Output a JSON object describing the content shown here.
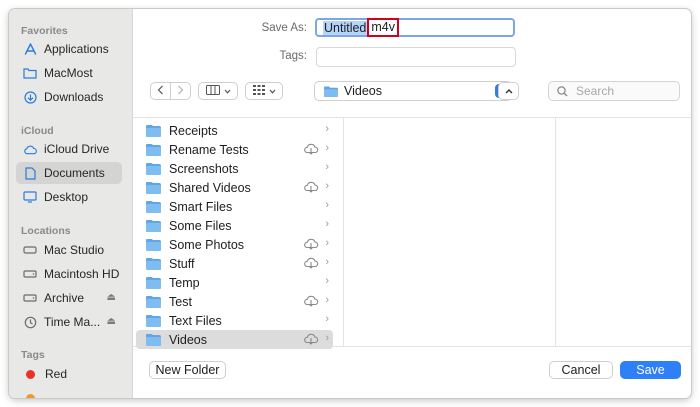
{
  "sidebar": {
    "favorites_heading": "Favorites",
    "favorites": [
      {
        "label": "Applications",
        "icon": "applications-icon"
      },
      {
        "label": "MacMost",
        "icon": "folder-icon"
      },
      {
        "label": "Downloads",
        "icon": "downloads-icon"
      }
    ],
    "icloud_heading": "iCloud",
    "icloud": [
      {
        "label": "iCloud Drive",
        "icon": "cloud-icon"
      },
      {
        "label": "Documents",
        "icon": "document-icon",
        "selected": true
      },
      {
        "label": "Desktop",
        "icon": "desktop-icon"
      }
    ],
    "locations_heading": "Locations",
    "locations": [
      {
        "label": "Mac Studio",
        "icon": "computer-icon"
      },
      {
        "label": "Macintosh HD",
        "icon": "drive-icon"
      },
      {
        "label": "Archive",
        "icon": "drive-icon",
        "ejectable": true
      },
      {
        "label": "Time Ma...",
        "icon": "time-machine-icon",
        "ejectable": true
      }
    ],
    "tags_heading": "Tags",
    "tags": [
      {
        "label": "Red",
        "color": "#e8332a"
      },
      {
        "label": "",
        "color": "#f0982f"
      }
    ]
  },
  "form": {
    "save_as_label": "Save As:",
    "filename_selected": "Untitled",
    "filename_extension": "m4v",
    "tags_label": "Tags:"
  },
  "toolbar": {
    "location": "Videos",
    "search_placeholder": "Search"
  },
  "browser": {
    "items": [
      {
        "name": "Receipts",
        "cloud": false
      },
      {
        "name": "Rename Tests",
        "cloud": true
      },
      {
        "name": "Screenshots",
        "cloud": false
      },
      {
        "name": "Shared Videos",
        "cloud": true
      },
      {
        "name": "Smart Files",
        "cloud": false
      },
      {
        "name": "Some Files",
        "cloud": false
      },
      {
        "name": "Some Photos",
        "cloud": true
      },
      {
        "name": "Stuff",
        "cloud": true
      },
      {
        "name": "Temp",
        "cloud": false
      },
      {
        "name": "Test",
        "cloud": true
      },
      {
        "name": "Text Files",
        "cloud": false
      },
      {
        "name": "Videos",
        "cloud": true,
        "selected": true
      }
    ]
  },
  "buttons": {
    "new_folder": "New Folder",
    "cancel": "Cancel",
    "save": "Save"
  },
  "colors": {
    "accent": "#2f7ff6",
    "folder": "#5fa6e6",
    "selection": "#b5d4fb",
    "highlight_box": "#d0021b"
  }
}
